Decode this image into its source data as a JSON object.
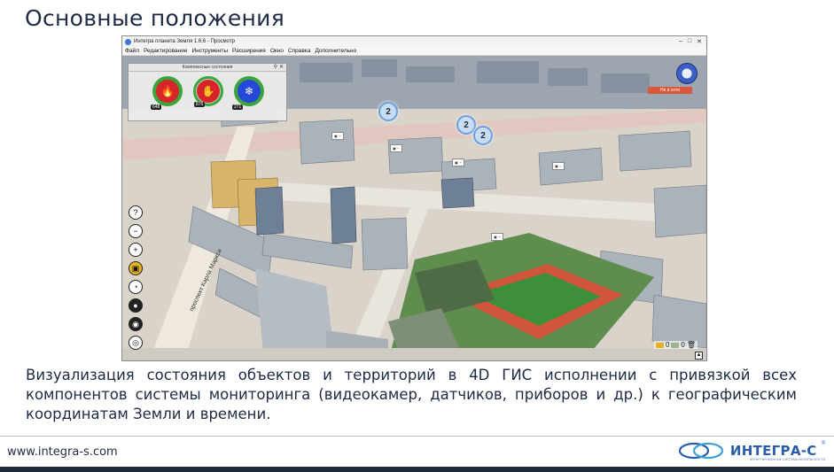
{
  "slide": {
    "title": "Основные положения",
    "caption": "Визуализация состояния объектов и территорий в 4D ГИС исполнении с привязкой всех компонентов системы мониторинга (видеокамер, датчиков, приборов и др.) к географическим координатам Земли и времени.",
    "website": "www.integra-s.com",
    "logo_text": "ИНТЕГРА-С",
    "logo_reg": "®",
    "logo_tagline": "ИНТЕГРИРОВАННЫЕ СИСТЕМЫ БЕЗОПАСНОСТИ"
  },
  "app": {
    "window_title": "Интегра планета Земля 1.6.6 - Просмотр",
    "window_controls": [
      "–",
      "□",
      "✕"
    ],
    "menu": [
      "Файл",
      "Редактирование",
      "Инструменты",
      "Расширения",
      "Окно",
      "Справка",
      "Дополнительно"
    ],
    "panel": {
      "title": "Комплексные состояния",
      "pin": "⚲",
      "close": "✕",
      "gauges": [
        {
          "name": "fire",
          "count": "648",
          "icon": "fire-person-icon",
          "glyph": "🔥"
        },
        {
          "name": "alarm",
          "count": "876",
          "icon": "alarm-hand-icon",
          "glyph": "✋"
        },
        {
          "name": "climate",
          "count": "271",
          "icon": "snowflake-icon",
          "glyph": "❄"
        }
      ]
    },
    "net_status": "Не в сети",
    "clusters": [
      "2",
      "2",
      "2"
    ],
    "counters": {
      "mail": "0",
      "alerts": "0"
    },
    "street_name": "проспект Карла Маркса",
    "tools": [
      "?",
      "−",
      "+",
      "▣",
      "◔",
      "●",
      "◉",
      "◎"
    ],
    "colors": {
      "accent": "#2a5db0",
      "title_text": "#1f2a44",
      "fire": "#d6262a",
      "ok": "#3aa53a",
      "climate": "#2548d9",
      "net_status": "#d9573a"
    }
  }
}
